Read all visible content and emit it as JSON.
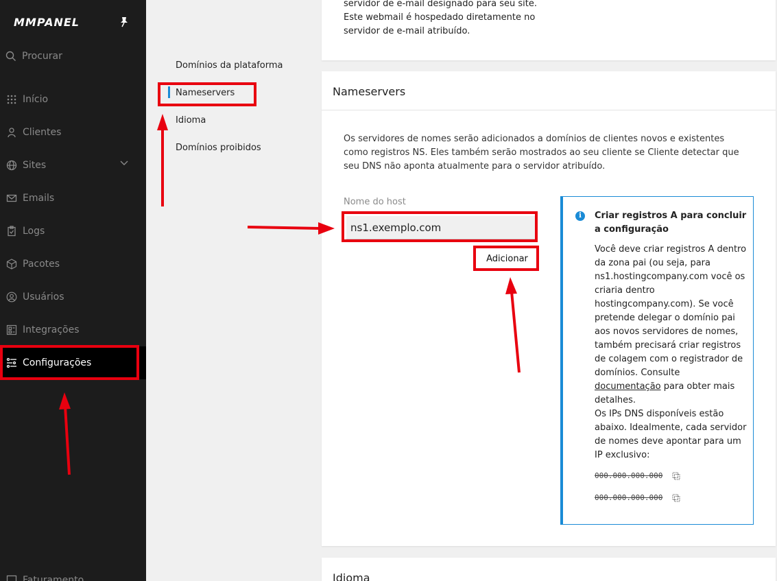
{
  "sidebar": {
    "logo": "MMPANEL",
    "search_label": "Procurar",
    "items": [
      {
        "label": "Início",
        "icon": "grid-icon"
      },
      {
        "label": "Clientes",
        "icon": "user-icon"
      },
      {
        "label": "Sites",
        "icon": "globe-icon"
      },
      {
        "label": "Emails",
        "icon": "mail-icon"
      },
      {
        "label": "Logs",
        "icon": "clipboard-icon"
      },
      {
        "label": "Pacotes",
        "icon": "package-icon"
      },
      {
        "label": "Usuários",
        "icon": "user-circle-icon"
      },
      {
        "label": "Integrações",
        "icon": "integrations-icon"
      },
      {
        "label": "Configurações",
        "icon": "settings-sliders-icon"
      },
      {
        "label": "Faturamento",
        "icon": "billing-icon"
      }
    ],
    "active_item": "Configurações"
  },
  "settings_nav": {
    "items": [
      "Domínios da plataforma",
      "Nameservers",
      "Idioma",
      "Domínios proibidos"
    ],
    "active": "Nameservers"
  },
  "top_card": {
    "text": "servidor de e-mail designado para seu site. Este webmail é hospedado diretamente no servidor de e-mail atribuído."
  },
  "nameservers": {
    "title": "Nameservers",
    "description": "Os servidores de nomes serão adicionados a domínios de clientes novos e existentes como registros NS. Eles também serão mostrados ao seu cliente se Cliente detectar que seu DNS não aponta atualmente para o servidor atribuído.",
    "host_label": "Nome do host",
    "host_value": "ns1.exemplo.com",
    "add_button": "Adicionar",
    "info": {
      "title": "Criar registros A para concluir a configuração",
      "body_before_link": "Você deve criar registros A dentro da zona pai (ou seja, para ns1.hostingcompany.com você os criaria dentro hostingcompany.com). Se você pretende delegar o domínio pai aos novos servidores de nomes, também precisará criar registros de colagem com o registrador de domínios. Consulte ",
      "link": "documentação",
      "body_after_link": " para obter mais detalhes.",
      "body2": "Os IPs DNS disponíveis estão abaixo. Idealmente, cada servidor de nomes deve apontar para um IP exclusivo:",
      "ips": [
        "000.000.000.000",
        "000.000.000.000"
      ]
    }
  },
  "idioma_card": {
    "title": "Idioma"
  },
  "colors": {
    "sidebar_bg": "#1c1c1c",
    "accent": "#1a8bd6",
    "annotation_red": "#e8000f"
  }
}
